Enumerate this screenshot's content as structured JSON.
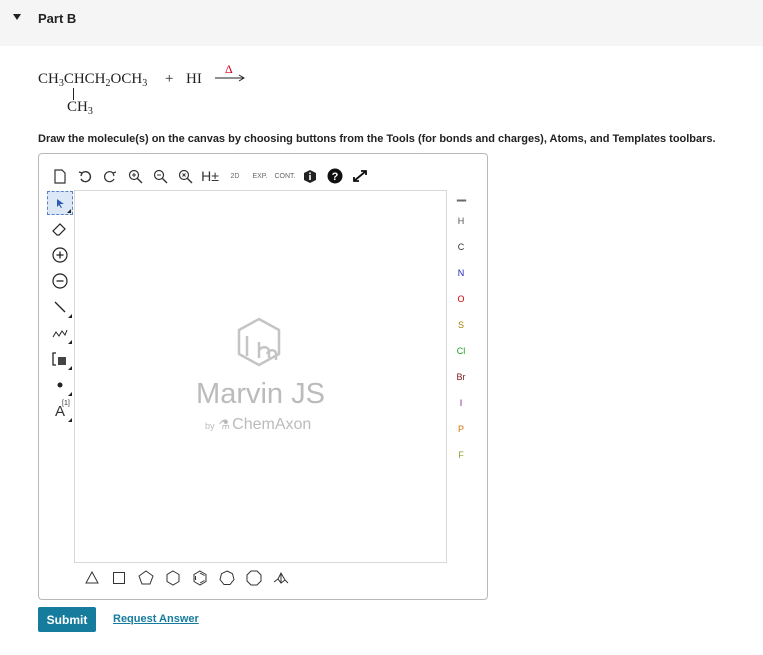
{
  "part": {
    "title": "Part B"
  },
  "reaction": {
    "reactant": {
      "ch3": "CH",
      "ch3_sub": "3",
      "chch": "CHCH",
      "ch2_sub": "2",
      "och": "OCH",
      "och3_sub": "3"
    },
    "plus": "+",
    "reagent": "HI",
    "condition": "Δ",
    "branch": {
      "ch": "CH",
      "sub": "3"
    }
  },
  "instruction": "Draw the molecule(s) on the canvas by choosing buttons from the Tools (for bonds and charges), Atoms, and Templates toolbars.",
  "editor": {
    "top_toolbar": {
      "h_label": "H±",
      "label_2d": "2D",
      "exp_label": "EXP.",
      "cont_label": "CONT."
    },
    "left_toolbar": {
      "text_tool_label": "A",
      "text_tool_sup": "[1]"
    },
    "watermark": {
      "title": "Marvin JS",
      "by": "by",
      "vendor": "ChemAxon"
    },
    "atoms": [
      {
        "symbol": "H",
        "color": "#555555"
      },
      {
        "symbol": "C",
        "color": "#333333"
      },
      {
        "symbol": "N",
        "color": "#2020c0"
      },
      {
        "symbol": "O",
        "color": "#d00000"
      },
      {
        "symbol": "S",
        "color": "#a08000"
      },
      {
        "symbol": "Cl",
        "color": "#1a9a1a"
      },
      {
        "symbol": "Br",
        "color": "#7a1a1a"
      },
      {
        "symbol": "I",
        "color": "#8a1aa0"
      },
      {
        "symbol": "P",
        "color": "#d07000"
      },
      {
        "symbol": "F",
        "color": "#8aa02a"
      }
    ],
    "templates": [
      "triangle",
      "square",
      "pentagon",
      "hexagon",
      "hexagon-benzene",
      "heptagon",
      "octagon",
      "chair"
    ]
  },
  "actions": {
    "submit": "Submit",
    "request_answer": "Request Answer"
  },
  "colors": {
    "accent": "#167c9e",
    "delta": "#d0021b",
    "header_bg": "#f5f5f5"
  }
}
